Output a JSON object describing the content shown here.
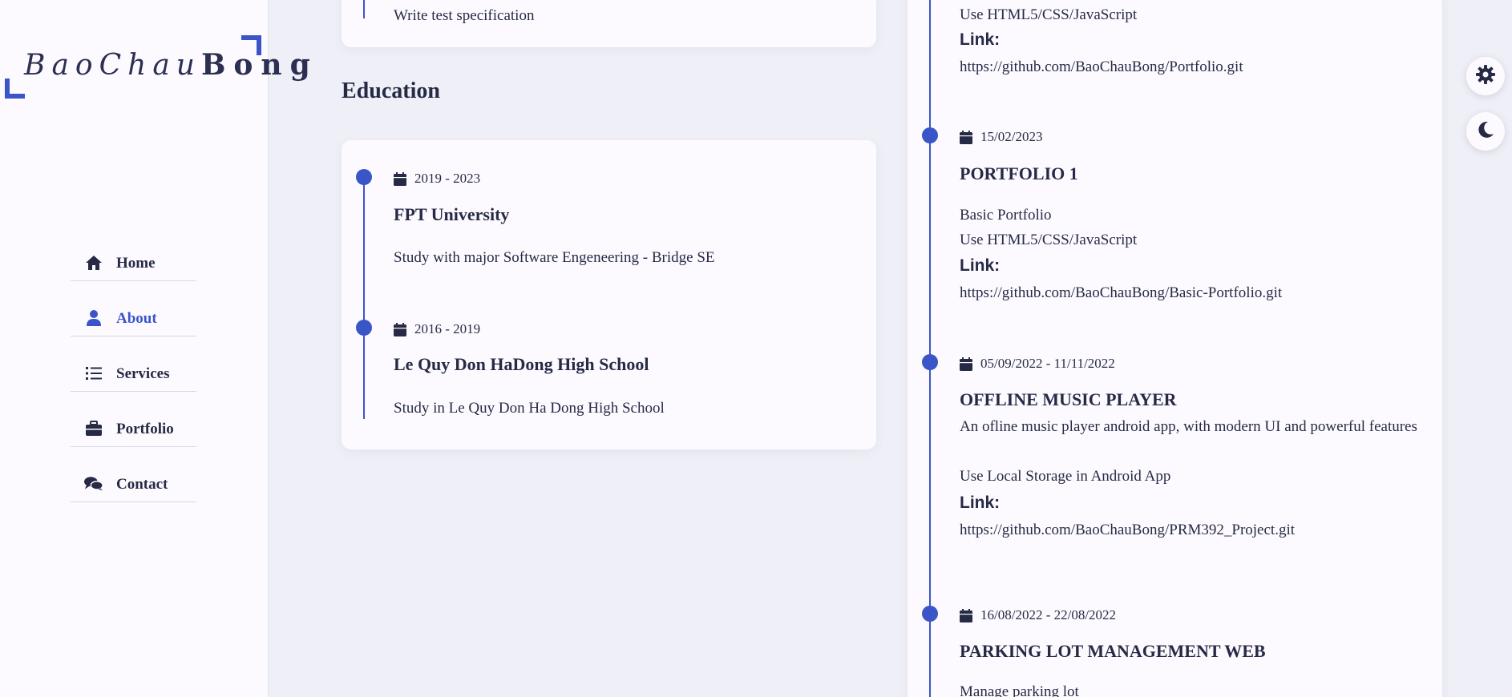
{
  "logo": {
    "script": "BaoChau",
    "bold": "Bong"
  },
  "nav": [
    {
      "label": "Home",
      "icon": "home-icon"
    },
    {
      "label": "About",
      "icon": "user-icon"
    },
    {
      "label": "Services",
      "icon": "list-icon"
    },
    {
      "label": "Portfolio",
      "icon": "briefcase-icon"
    },
    {
      "label": "Contact",
      "icon": "comments-icon"
    }
  ],
  "top_card": {
    "text": "Write test specification"
  },
  "education": {
    "title": "Education",
    "items": [
      {
        "date": "2019 - 2023",
        "title": "FPT University",
        "desc": "Study with major Software Engeneering - Bridge SE"
      },
      {
        "date": "2016 - 2019",
        "title": "Le Quy Don HaDong High School",
        "desc": "Study in Le Quy Don Ha Dong High School"
      }
    ]
  },
  "projects": {
    "top": {
      "tech": "Use HTML5/CSS/JavaScript",
      "link_label": "Link:",
      "url": "https://github.com/BaoChauBong/Portfolio.git"
    },
    "items": [
      {
        "date": "15/02/2023",
        "title": "PORTFOLIO 1",
        "desc1": "Basic Portfolio",
        "desc2": "Use HTML5/CSS/JavaScript",
        "link_label": "Link:",
        "url": "https://github.com/BaoChauBong/Basic-Portfolio.git"
      },
      {
        "date": "05/09/2022 - 11/11/2022",
        "title": "OFFLINE MUSIC PLAYER",
        "desc1": "An ofline music player android app, with modern UI and powerful features",
        "desc2": "Use Local Storage in Android App",
        "link_label": "Link:",
        "url": "https://github.com/BaoChauBong/PRM392_Project.git"
      },
      {
        "date": "16/08/2022 - 22/08/2022",
        "title": "PARKING LOT MANAGEMENT WEB",
        "desc1": "Manage parking lot"
      }
    ]
  },
  "colors": {
    "accent": "#3a55c8",
    "text": "#262a45",
    "bg": "#eff0f7",
    "card": "#fdfaff"
  }
}
